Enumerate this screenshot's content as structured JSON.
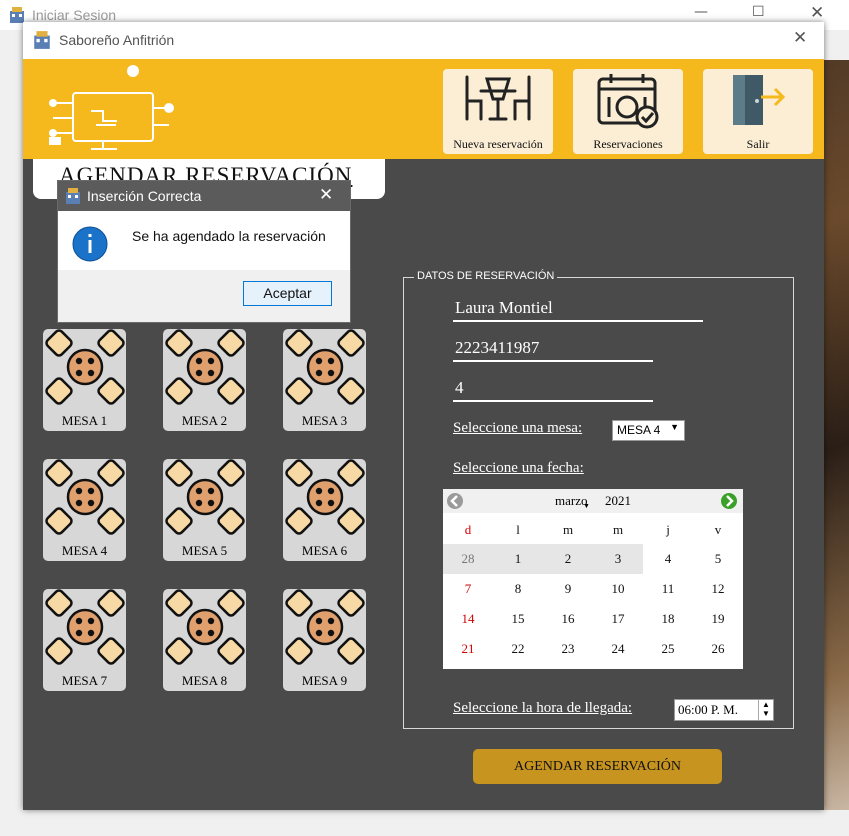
{
  "background_window": {
    "title": "Iniciar Sesion"
  },
  "window": {
    "title": "Saboreño Anfitrión"
  },
  "header": {
    "buttons": [
      {
        "label": "Nueva reservación",
        "icon": "dining-table-icon"
      },
      {
        "label": "Reservaciones",
        "icon": "calendar-plate-icon"
      },
      {
        "label": "Salir",
        "icon": "exit-door-icon"
      }
    ]
  },
  "page": {
    "heading": "AGENDAR RESERVACIÓN"
  },
  "tables": [
    {
      "label": "MESA 1"
    },
    {
      "label": "MESA 4"
    },
    {
      "label": "MESA 7"
    },
    {
      "label": "MESA 2"
    },
    {
      "label": "MESA 5"
    },
    {
      "label": "MESA 8"
    },
    {
      "label": "MESA 3"
    },
    {
      "label": "MESA 6"
    },
    {
      "label": "MESA 9"
    }
  ],
  "form": {
    "legend": "DATOS DE RESERVACIÓN",
    "name": "Laura Montiel",
    "phone": "2223411987",
    "guests": "4",
    "select_table_label": "Seleccione una mesa:",
    "selected_table": "MESA 4",
    "select_date_label": "Seleccione una fecha:",
    "select_time_label": "Seleccione la hora de llegada:",
    "time": "06:00 P. M.",
    "submit": "AGENDAR RESERVACIÓN"
  },
  "calendar": {
    "month": "marzo",
    "year": "2021",
    "weekdays": [
      "d",
      "l",
      "m",
      "m",
      "j",
      "v"
    ],
    "weeks": [
      [
        "28",
        "1",
        "2",
        "3",
        "4",
        "5"
      ],
      [
        "7",
        "8",
        "9",
        "10",
        "11",
        "12"
      ],
      [
        "14",
        "15",
        "16",
        "17",
        "18",
        "19"
      ],
      [
        "21",
        "22",
        "23",
        "24",
        "25",
        "26"
      ]
    ]
  },
  "dialog": {
    "title": "Inserción Correcta",
    "message": "Se ha agendado la reservación",
    "ok": "Aceptar"
  },
  "colors": {
    "header": "#f5b81d",
    "panel": "#4a4a4a",
    "submit": "#c7951f",
    "sunday": "#d40000"
  }
}
